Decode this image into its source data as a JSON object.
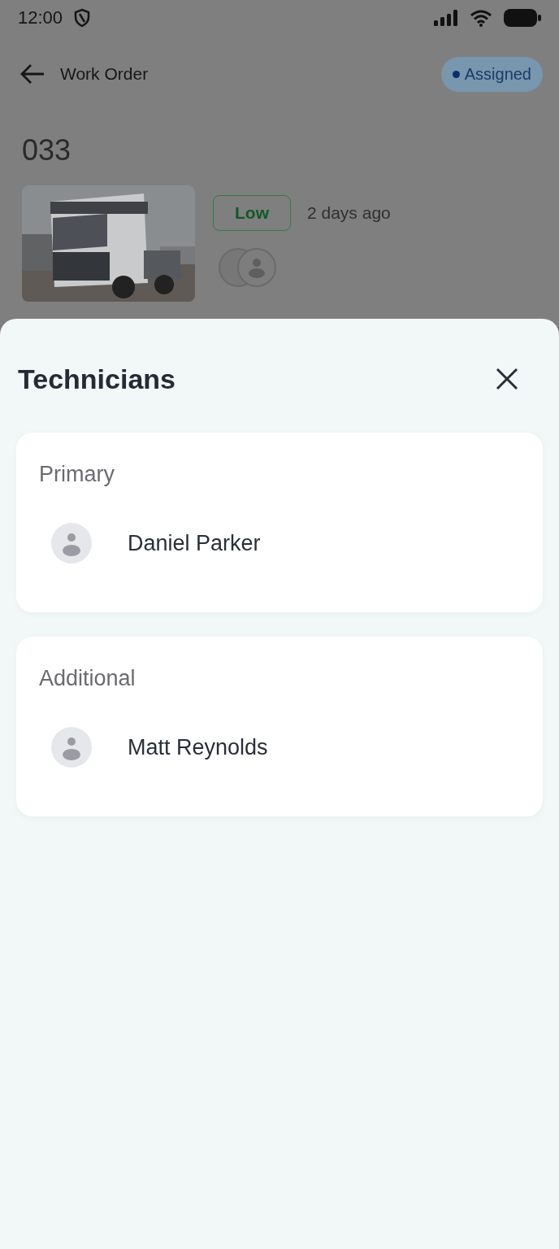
{
  "status_bar": {
    "time": "12:00"
  },
  "header": {
    "title": "Work Order",
    "status": "Assigned"
  },
  "work_order": {
    "number": "033",
    "priority": "Low",
    "age": "2 days ago"
  },
  "sheet": {
    "title": "Technicians",
    "groups": [
      {
        "label": "Primary",
        "technicians": [
          {
            "name": "Daniel Parker"
          }
        ]
      },
      {
        "label": "Additional",
        "technicians": [
          {
            "name": "Matt Reynolds"
          }
        ]
      }
    ]
  }
}
